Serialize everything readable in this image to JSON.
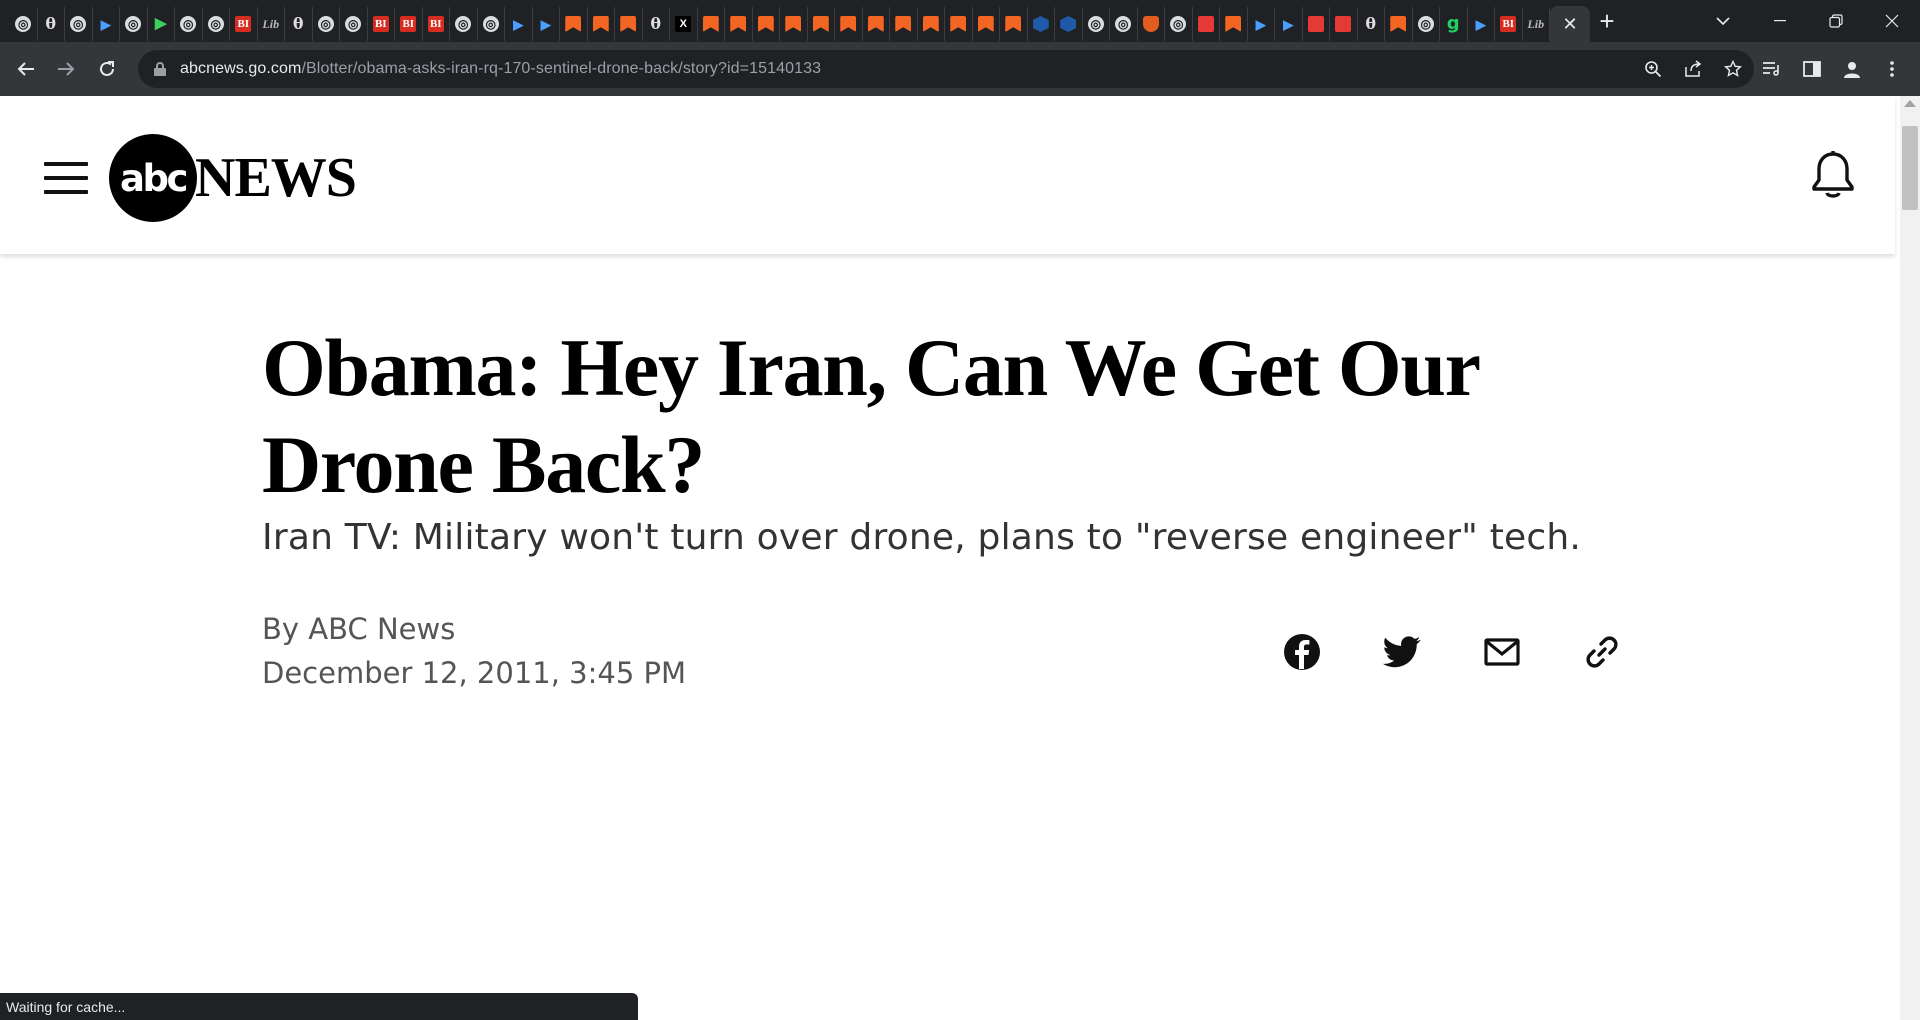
{
  "browser": {
    "tabs_favicons": [
      "globe",
      "theta",
      "globe",
      "blue",
      "globe",
      "green",
      "globe",
      "globe",
      "bi",
      "lite",
      "theta",
      "globe",
      "globe",
      "bi",
      "bi",
      "bi",
      "globe",
      "globe",
      "blue",
      "blue",
      "orange",
      "orange",
      "orange",
      "theta",
      "x",
      "orange",
      "orange",
      "orange",
      "orange",
      "orange",
      "orange",
      "orange",
      "orange",
      "orange",
      "orange",
      "orange",
      "orange",
      "hex",
      "hex",
      "globe",
      "globe",
      "shield",
      "globe",
      "red",
      "orange",
      "blue",
      "blue",
      "red",
      "red",
      "theta",
      "orange",
      "globe",
      "g",
      "blue",
      "bi",
      "lite"
    ],
    "tab_glyphs": {
      "globe": "◎",
      "theta": "θ",
      "blue": "▶",
      "green": "▶",
      "bi": "BI",
      "lite": "Lib",
      "orange": "",
      "x": "X",
      "hex": "",
      "shield": "",
      "red": "",
      "g": "g"
    },
    "active_tab_close": "✕",
    "new_tab": "+",
    "url_host": "abcnews.go.com",
    "url_path": "/Blotter/obama-asks-iran-rq-170-sentinel-drone-back/story?id=15140133",
    "status_text": "Waiting for cache..."
  },
  "site": {
    "logo_abc": "abc",
    "logo_news": "NEWS"
  },
  "article": {
    "headline": "Obama: Hey Iran, Can We Get Our Drone Back?",
    "subheadline": "Iran TV: Military won't turn over drone, plans to \"reverse engineer\" tech.",
    "byline": "By ABC News",
    "date": "December 12, 2011, 3:45 PM"
  }
}
